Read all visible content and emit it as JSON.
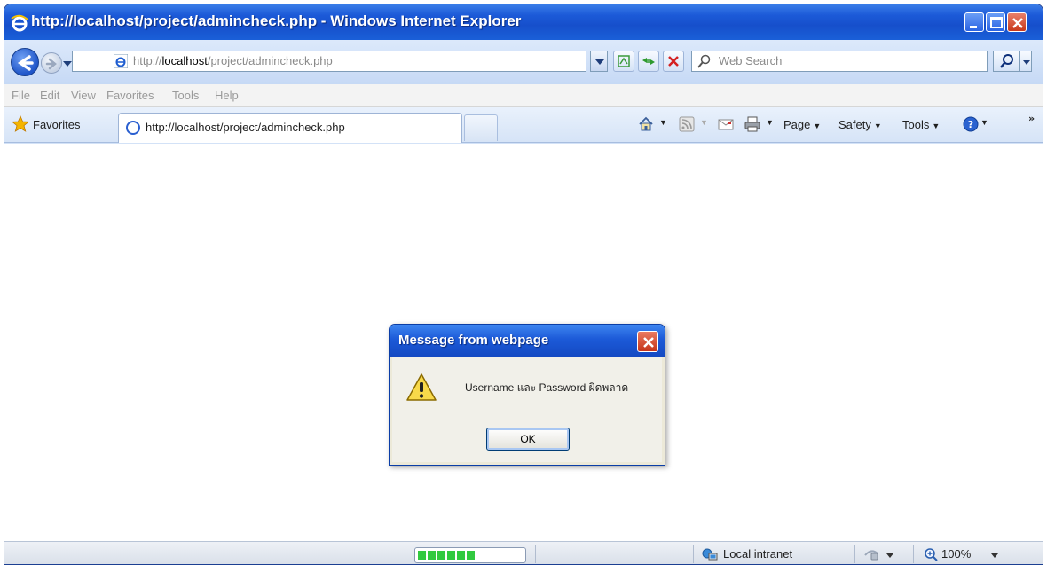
{
  "window": {
    "title": "http://localhost/project/admincheck.php - Windows Internet Explorer"
  },
  "address_bar": {
    "prefix": "http://",
    "host": "localhost",
    "path": "/project/admincheck.php"
  },
  "search": {
    "placeholder": "Web Search"
  },
  "menu": {
    "items": [
      "File",
      "Edit",
      "View",
      "Favorites",
      "Tools",
      "Help"
    ]
  },
  "favorites_bar": {
    "favorites_label": "Favorites",
    "tab_label": "http://localhost/project/admincheck.php",
    "commands": [
      "Page",
      "Safety",
      "Tools"
    ]
  },
  "dialog": {
    "title": "Message from webpage",
    "message": "Username และ Password ผิดพลาด",
    "ok_label": "OK"
  },
  "status_bar": {
    "zone": "Local intranet",
    "zoom": "100%",
    "progress_fraction": 0.55
  },
  "colors": {
    "titlebar": "#1c5ad8",
    "dialog_face": "#ece9d8",
    "progress": "#31c940",
    "close_red": "#c9381a"
  },
  "icons": {
    "back": "back-arrow-icon",
    "forward": "forward-arrow-icon",
    "refresh": "refresh-icon",
    "stop": "stop-icon",
    "compatibility": "compatibility-view-icon",
    "search": "search-icon",
    "home": "home-icon",
    "feeds": "rss-feed-icon",
    "mail": "mail-icon",
    "print": "print-icon",
    "help": "help-icon",
    "warning": "warning-icon",
    "zone": "network-zone-icon",
    "zoom": "zoom-icon"
  }
}
